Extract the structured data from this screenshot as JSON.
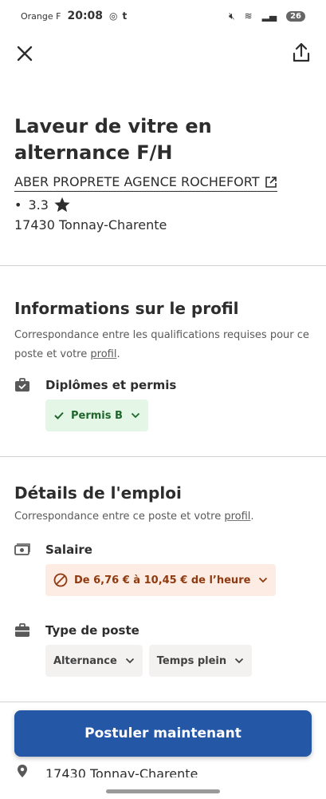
{
  "status_bar": {
    "carrier": "Orange F",
    "time": "20:08",
    "battery": "26"
  },
  "job": {
    "title": "Laveur de vitre en alternance F/H",
    "company": "ABER PROPRETE AGENCE ROCHEFORT",
    "rating": "3.3",
    "location": "17430 Tonnay-Charente"
  },
  "profile": {
    "title": "Informations sur le profil",
    "desc": "Correspondance entre les qualifications requises pour ce poste et votre",
    "link": "profil",
    "diplomas_label": "Diplômes et permis",
    "diplomas_chip": "Permis B"
  },
  "details": {
    "title": "Détails de l'emploi",
    "desc": "Correspondance entre ce poste et votre",
    "link": "profil",
    "salary_label": "Salaire",
    "salary_chip": "De 6,76 € à 10,45 € de l’heure",
    "type_label": "Type de poste",
    "type_chips": [
      "Alternance",
      "Temps plein"
    ]
  },
  "apply_label": "Postuler maintenant",
  "peek_location": "17430 Tonnay-Charente",
  "colors": {
    "apply": "#2557a7",
    "match_green": "#1f662c",
    "mismatch_orange": "#8f3a10"
  },
  "icons": [
    "close-icon",
    "share-icon",
    "external-link-icon",
    "star-icon",
    "briefcase-check-icon",
    "money-icon",
    "briefcase-icon",
    "check-icon",
    "not-allowed-icon",
    "chevron-down-icon",
    "location-icon"
  ]
}
